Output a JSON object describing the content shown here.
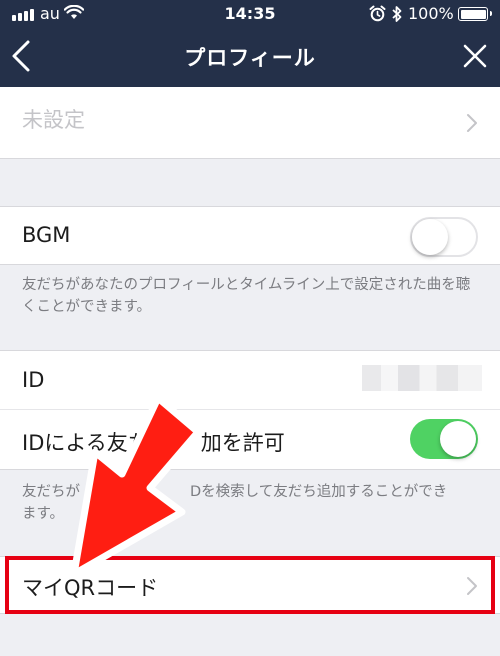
{
  "status_bar": {
    "carrier": "au",
    "time": "14:35",
    "battery": "100%"
  },
  "nav": {
    "title": "プロフィール"
  },
  "rows": {
    "unset": {
      "label": "未設定"
    },
    "bgm": {
      "label": "BGM",
      "enabled": false
    },
    "bgm_desc": "友だちがあなたのプロフィールとタイムライン上で設定された曲を聴くことができます。",
    "id": {
      "label": "ID"
    },
    "id_search": {
      "label": "IDによる友だち追加を許可",
      "visible_label": "IDによる友た",
      "visible_label_tail": "加を許可",
      "enabled": true
    },
    "id_desc_head": "友だちが",
    "id_desc_mid": "Dを検索して友だち追加することができ",
    "id_desc_tail": "ます。",
    "qr": {
      "label": "マイQRコード"
    }
  },
  "colors": {
    "header_bg": "#243049",
    "page_bg": "#eeeff3",
    "toggle_on": "#4fd263",
    "annotation_red": "#e60012"
  },
  "icons": [
    "back-chevron-icon",
    "close-icon",
    "chevron-right-icon",
    "wifi-icon",
    "alarm-icon",
    "bluetooth-icon",
    "battery-icon"
  ]
}
